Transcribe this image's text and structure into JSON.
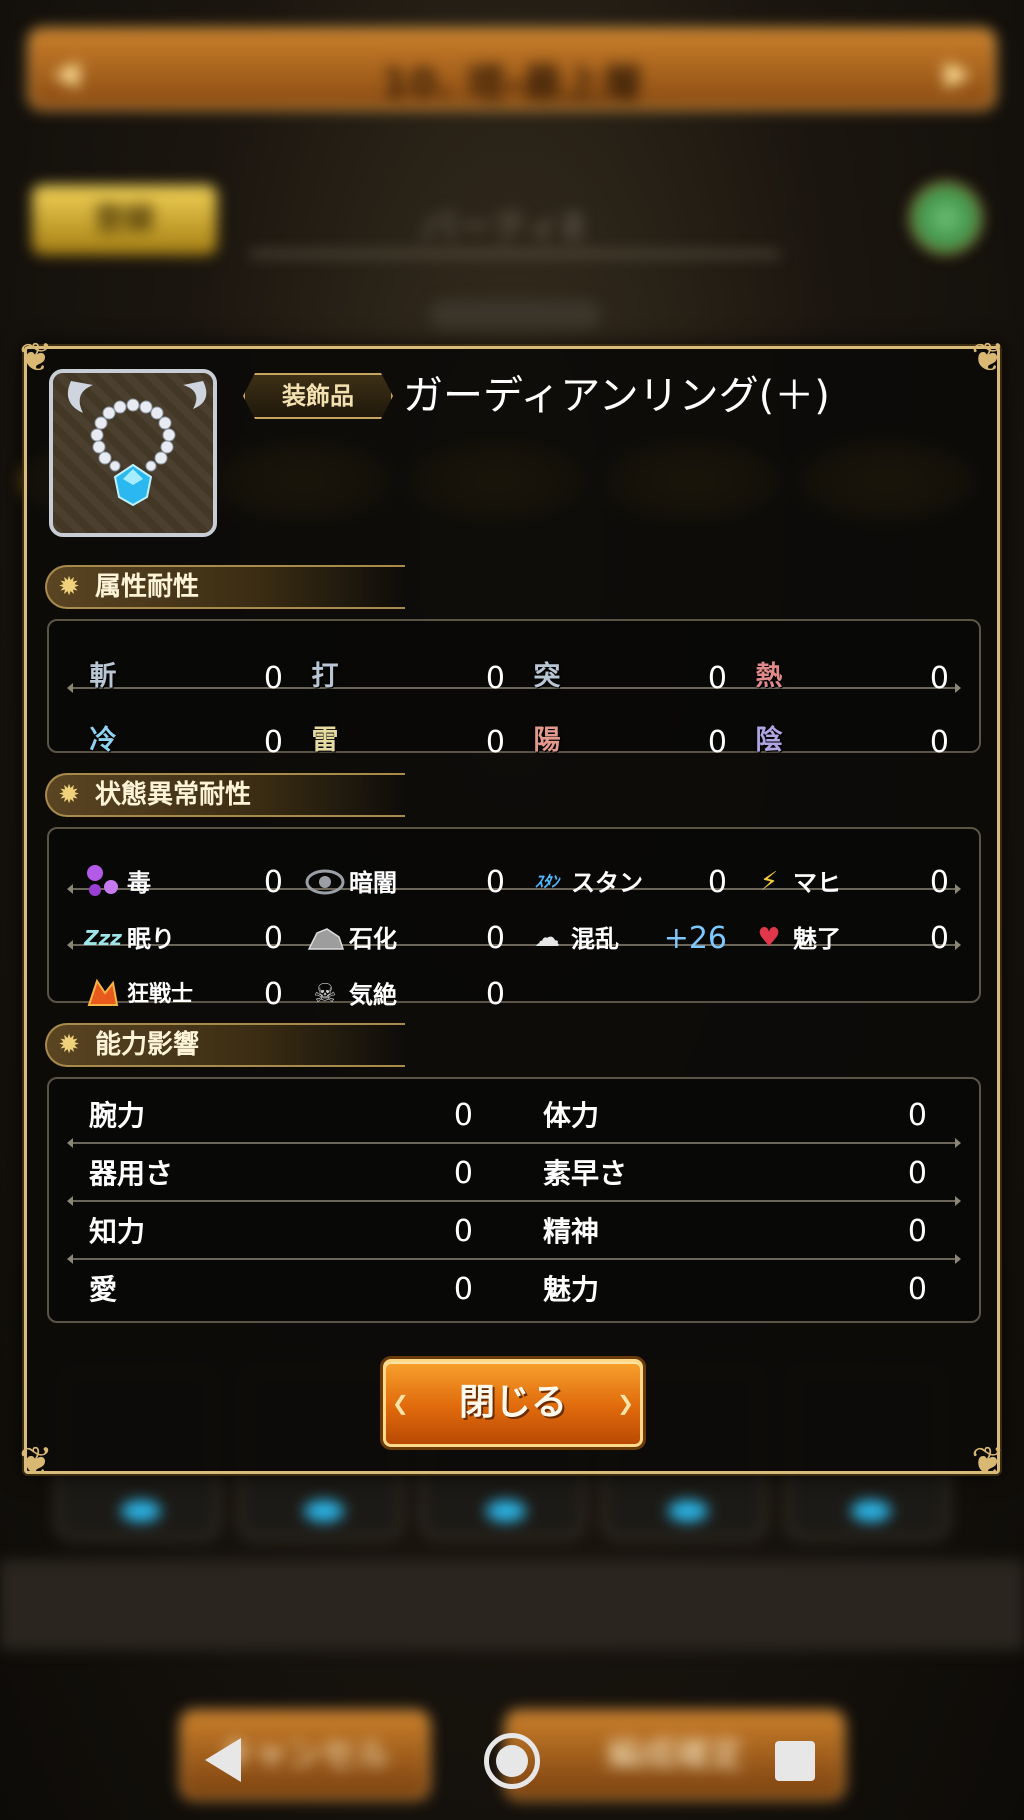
{
  "background": {
    "title": "10. 塔-最上層",
    "set_button": "登録",
    "party_label": "パーティ8",
    "cancel_button": "キャンセル",
    "confirm_button": "編成確定"
  },
  "item": {
    "icon": "pearl-necklace-with-blue-gem-icon",
    "category": "装飾品",
    "name": "ガーディアンリング(＋)"
  },
  "elements": {
    "title": "属性耐性",
    "rows": [
      [
        {
          "icon": "slash-element-icon",
          "glyph": "斬",
          "value": "0",
          "color": "#b9c6d3"
        },
        {
          "icon": "strike-element-icon",
          "glyph": "打",
          "value": "0",
          "color": "#b9c6d3"
        },
        {
          "icon": "pierce-element-icon",
          "glyph": "突",
          "value": "0",
          "color": "#b9c6d3"
        },
        {
          "icon": "heat-element-icon",
          "glyph": "熱",
          "value": "0",
          "color": "#e08a8a"
        }
      ],
      [
        {
          "icon": "cold-element-icon",
          "glyph": "冷",
          "value": "0",
          "color": "#8fd1ee"
        },
        {
          "icon": "thunder-element-icon",
          "glyph": "雷",
          "value": "0",
          "color": "#e6dba0"
        },
        {
          "icon": "light-element-icon",
          "glyph": "陽",
          "value": "0",
          "color": "#e39a8d"
        },
        {
          "icon": "dark-element-icon",
          "glyph": "陰",
          "value": "0",
          "color": "#b0a4e2"
        }
      ]
    ]
  },
  "status": {
    "title": "状態異常耐性",
    "rows": [
      [
        {
          "icon": "poison-icon",
          "label": "毒",
          "value": "0"
        },
        {
          "icon": "blind-eye-icon",
          "label": "暗闇",
          "value": "0"
        },
        {
          "icon": "stun-icon",
          "label": "スタン",
          "value": "0"
        },
        {
          "icon": "paralysis-icon",
          "label": "マヒ",
          "value": "0"
        }
      ],
      [
        {
          "icon": "sleep-icon",
          "label": "眠り",
          "value": "0"
        },
        {
          "icon": "petrify-icon",
          "label": "石化",
          "value": "0"
        },
        {
          "icon": "confusion-icon",
          "label": "混乱",
          "value": "+26"
        },
        {
          "icon": "charm-heart-icon",
          "label": "魅了",
          "value": "0"
        }
      ],
      [
        {
          "icon": "berserk-icon",
          "label": "狂戦士",
          "value": "0"
        },
        {
          "icon": "faint-skull-icon",
          "label": "気絶",
          "value": "0"
        }
      ]
    ]
  },
  "abilities": {
    "title": "能力影響",
    "rows": [
      [
        {
          "label": "腕力",
          "value": "0"
        },
        {
          "label": "体力",
          "value": "0"
        }
      ],
      [
        {
          "label": "器用さ",
          "value": "0"
        },
        {
          "label": "素早さ",
          "value": "0"
        }
      ],
      [
        {
          "label": "知力",
          "value": "0"
        },
        {
          "label": "精神",
          "value": "0"
        }
      ],
      [
        {
          "label": "愛",
          "value": "0"
        },
        {
          "label": "魅力",
          "value": "0"
        }
      ]
    ]
  },
  "close_button": "閉じる",
  "system_nav": {
    "back": "back-triangle-icon",
    "home": "home-circle-icon",
    "recent": "recent-apps-square-icon"
  },
  "colors": {
    "accent_gold": "#d9bc7a",
    "positive_value": "#7ec7ff",
    "close_button": "#e06a0c"
  }
}
